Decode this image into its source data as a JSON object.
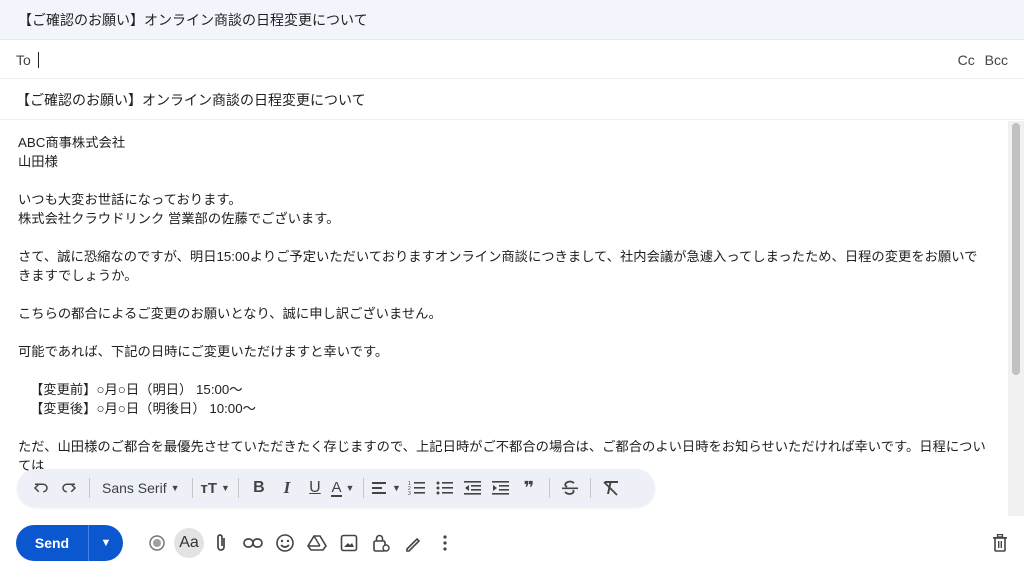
{
  "window": {
    "title": "【ご確認のお願い】オンライン商談の日程変更について"
  },
  "recipients": {
    "to_label": "To",
    "cc_label": "Cc",
    "bcc_label": "Bcc"
  },
  "subject": "【ご確認のお願い】オンライン商談の日程変更について",
  "body": {
    "lines": [
      "ABC商事株式会社",
      "山田様",
      "",
      "いつも大変お世話になっております。",
      "株式会社クラウドリンク 営業部の佐藤でございます。",
      "",
      "さて、誠に恐縮なのですが、明日15:00よりご予定いただいておりますオンライン商談につきまして、社内会議が急遽入ってしまったため、日程の変更をお願いできますでしょうか。",
      "",
      "こちらの都合によるご変更のお願いとなり、誠に申し訳ございません。",
      "",
      "可能であれば、下記の日時にご変更いただけますと幸いです。",
      "",
      "【変更前】○月○日（明日） 15:00〜",
      "【変更後】○月○日（明後日） 10:00〜",
      "",
      "ただ、山田様のご都合を最優先させていただきたく存じますので、上記日時がご不都合の場合は、ご都合のよい日時をお知らせいただければ幸いです。日程については"
    ]
  },
  "formatting_toolbar": {
    "font_family": "Sans Serif",
    "icons": [
      "undo-icon",
      "redo-icon",
      "font-size-icon",
      "bold-icon",
      "italic-icon",
      "underline-icon",
      "text-color-icon",
      "align-icon",
      "numbered-list-icon",
      "bulleted-list-icon",
      "indent-less-icon",
      "indent-more-icon",
      "quote-icon",
      "strikethrough-icon",
      "remove-formatting-icon"
    ]
  },
  "bottom_toolbar": {
    "send_label": "Send",
    "icons": [
      "ai-icon",
      "formatting-options-icon",
      "attach-icon",
      "link-icon",
      "emoji-icon",
      "drive-icon",
      "photo-icon",
      "confidential-icon",
      "signature-icon",
      "more-options-icon",
      "trash-icon"
    ]
  },
  "colors": {
    "accent": "#0b57d0",
    "titlebar_bg": "#f2f6fc",
    "toolbar_bg": "#edf1f7"
  }
}
